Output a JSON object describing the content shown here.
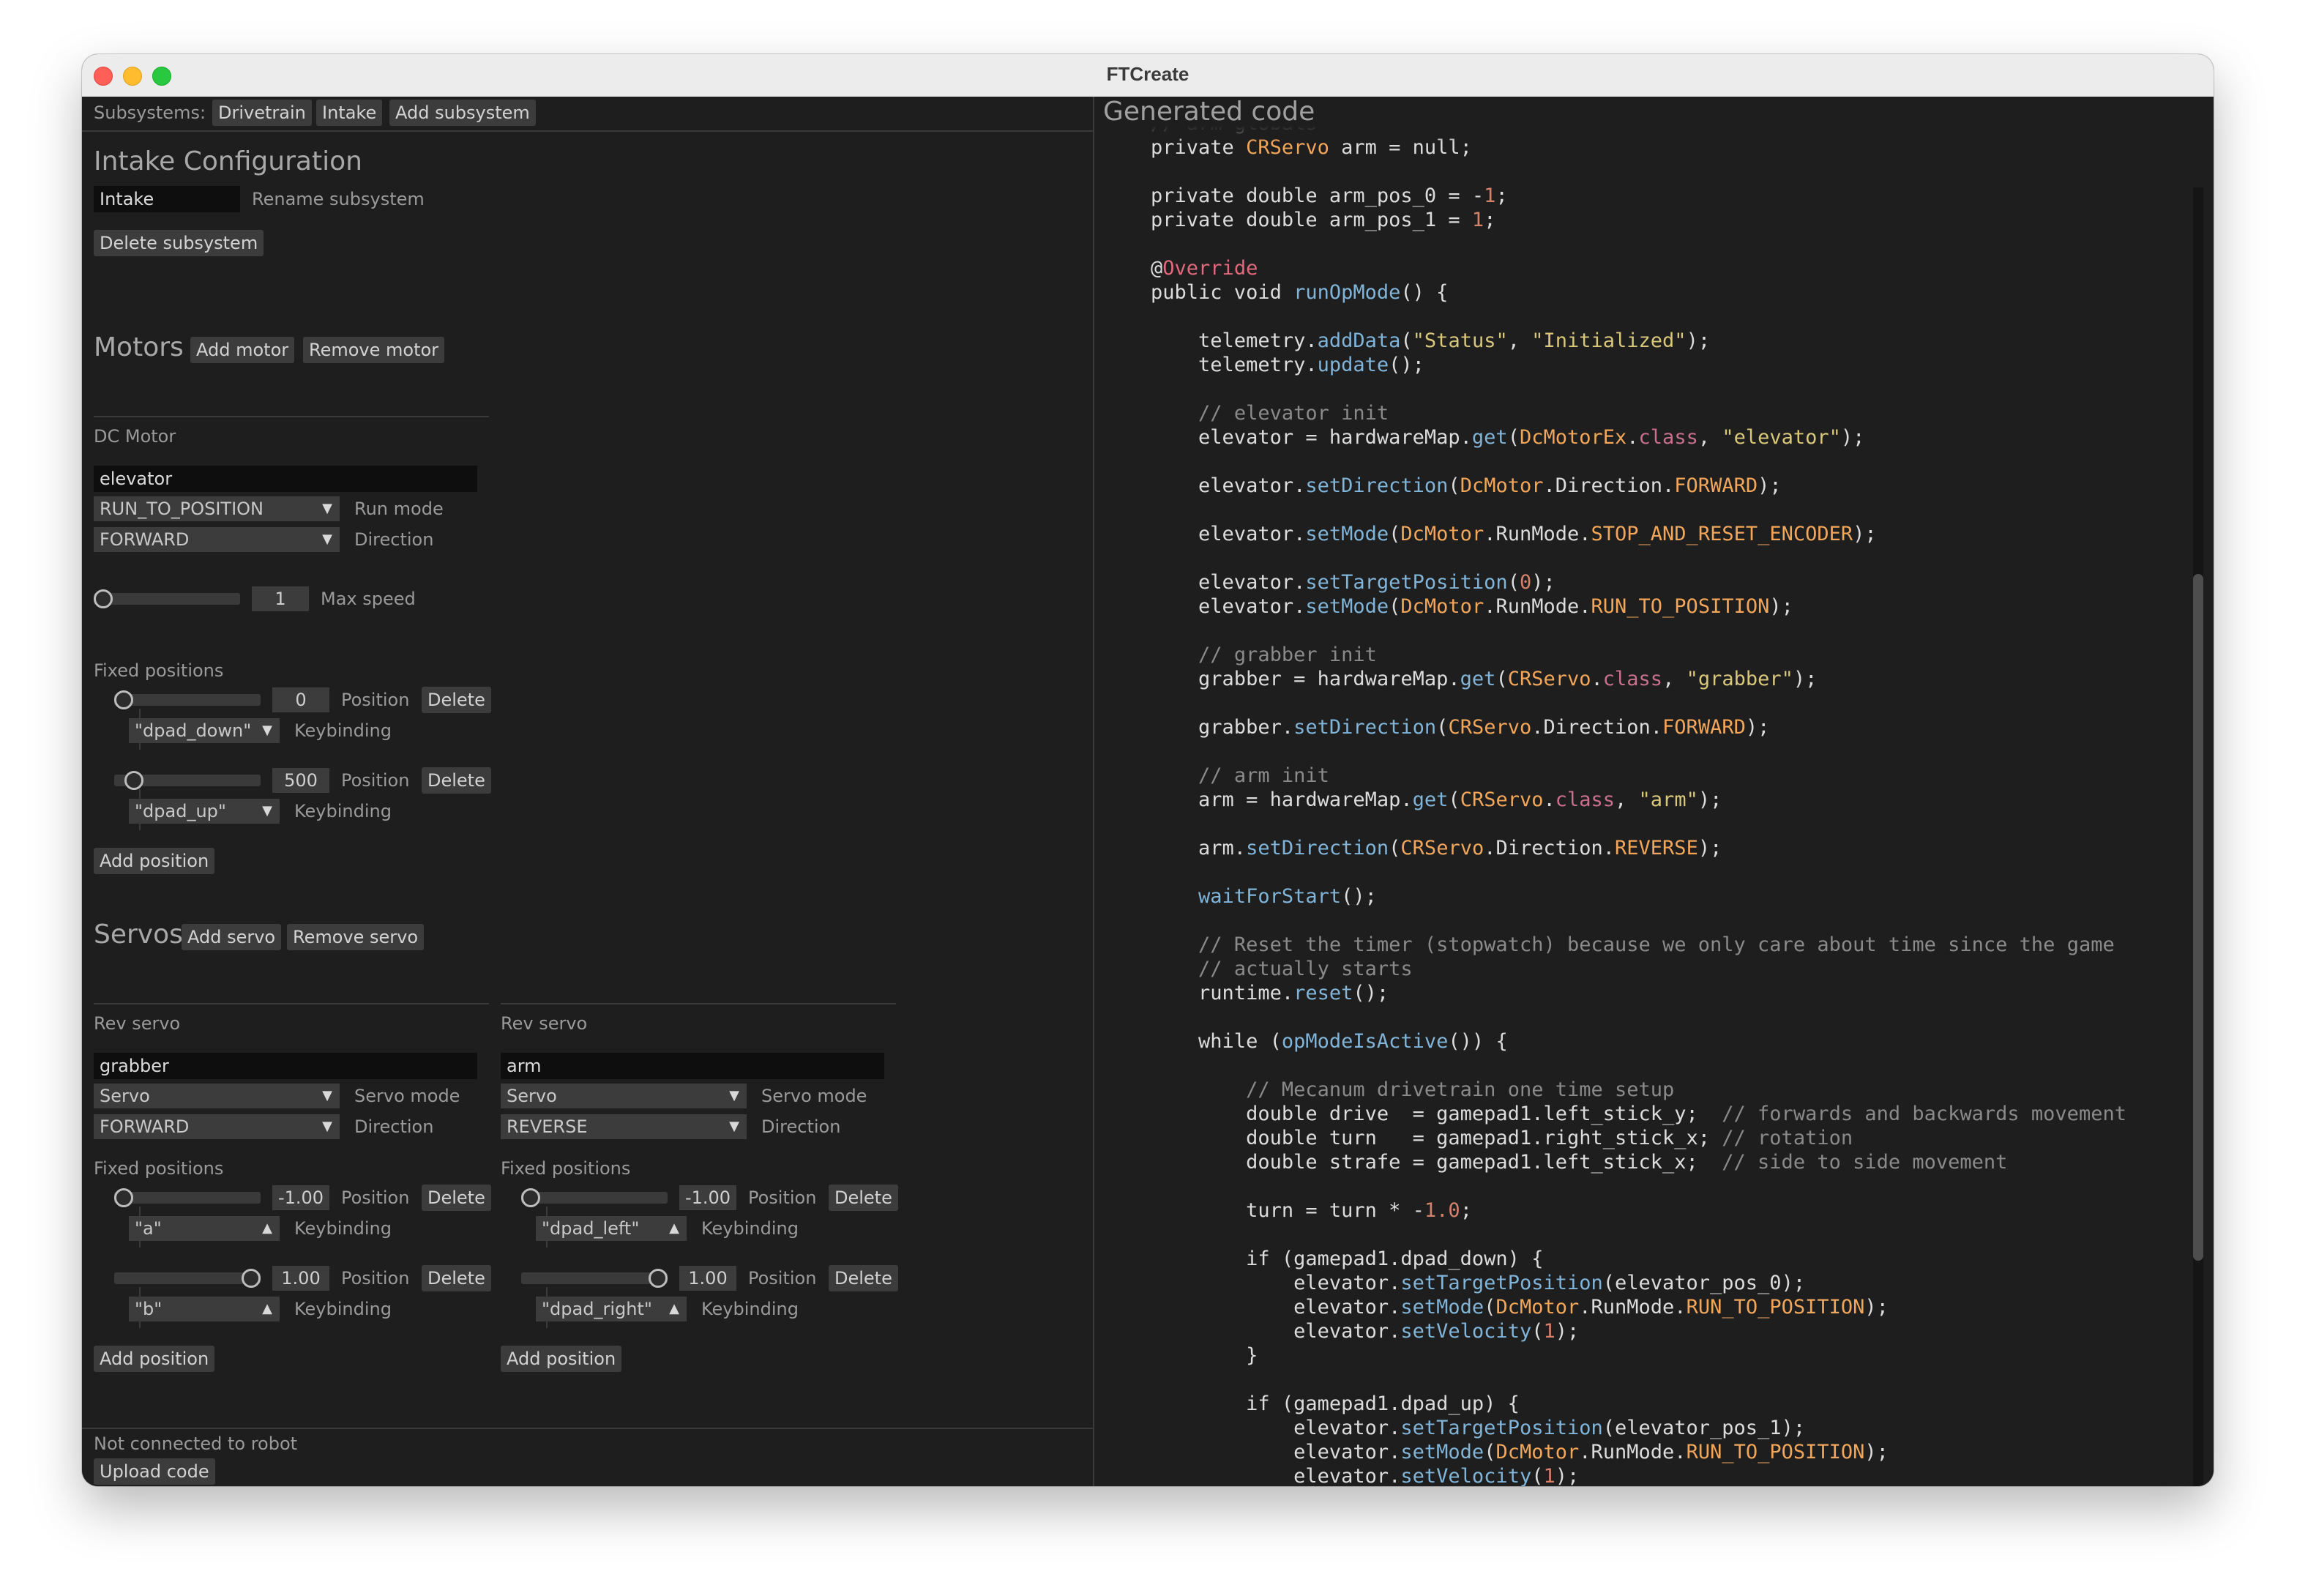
{
  "window": {
    "title": "FTCreate"
  },
  "toolbar": {
    "label": "Subsystems:",
    "tabs": [
      "Drivetrain",
      "Intake"
    ],
    "add_subsystem": "Add subsystem"
  },
  "config": {
    "heading": "Intake Configuration",
    "name_value": "Intake",
    "rename_label": "Rename subsystem",
    "delete_label": "Delete subsystem"
  },
  "motors": {
    "heading": "Motors",
    "add": "Add motor",
    "remove": "Remove motor",
    "items": [
      {
        "type": "DC Motor",
        "name": "elevator",
        "run_mode": "RUN_TO_POSITION",
        "run_mode_label": "Run mode",
        "direction": "FORWARD",
        "direction_label": "Direction",
        "max_speed": "1",
        "max_speed_label": "Max speed",
        "max_speed_level": 0.0,
        "fixed_label": "Fixed positions",
        "positions": [
          {
            "value": "0",
            "level": 0.0,
            "position_label": "Position",
            "delete": "Delete",
            "key": "\"dpad_down\"",
            "key_label": "Keybinding"
          },
          {
            "value": "500",
            "level": 0.08,
            "position_label": "Position",
            "delete": "Delete",
            "key": "\"dpad_up\"",
            "key_label": "Keybinding"
          }
        ],
        "add_position": "Add position"
      }
    ]
  },
  "servos": {
    "heading": "Servos",
    "add": "Add servo",
    "remove": "Remove servo",
    "items": [
      {
        "type": "Rev servo",
        "name": "grabber",
        "mode": "Servo",
        "mode_label": "Servo mode",
        "direction": "FORWARD",
        "direction_label": "Direction",
        "fixed_label": "Fixed positions",
        "positions": [
          {
            "value": "-1.00",
            "level": 0.0,
            "position_label": "Position",
            "delete": "Delete",
            "key": "\"a\"",
            "key_label": "Keybinding"
          },
          {
            "value": "1.00",
            "level": 1.0,
            "position_label": "Position",
            "delete": "Delete",
            "key": "\"b\"",
            "key_label": "Keybinding"
          }
        ],
        "add_position": "Add position"
      },
      {
        "type": "Rev servo",
        "name": "arm",
        "mode": "Servo",
        "mode_label": "Servo mode",
        "direction": "REVERSE",
        "direction_label": "Direction",
        "fixed_label": "Fixed positions",
        "positions": [
          {
            "value": "-1.00",
            "level": 0.0,
            "position_label": "Position",
            "delete": "Delete",
            "key": "\"dpad_left\"",
            "key_label": "Keybinding"
          },
          {
            "value": "1.00",
            "level": 1.0,
            "position_label": "Position",
            "delete": "Delete",
            "key": "\"dpad_right\"",
            "key_label": "Keybinding"
          }
        ],
        "add_position": "Add position"
      }
    ]
  },
  "status": {
    "text": "Not connected to robot",
    "upload": "Upload code"
  },
  "code": {
    "title": "Generated code",
    "lines": [
      "    // arm globals",
      "    private CRServo arm = null;",
      "",
      "    private double arm_pos_0 = -1;",
      "    private double arm_pos_1 = 1;",
      "",
      "    @Override",
      "    public void runOpMode() {",
      "",
      "        telemetry.addData(\"Status\", \"Initialized\");",
      "        telemetry.update();",
      "",
      "        // elevator init",
      "        elevator = hardwareMap.get(DcMotorEx.class, \"elevator\");",
      "",
      "        elevator.setDirection(DcMotor.Direction.FORWARD);",
      "",
      "        elevator.setMode(DcMotor.RunMode.STOP_AND_RESET_ENCODER);",
      "",
      "        elevator.setTargetPosition(0);",
      "        elevator.setMode(DcMotor.RunMode.RUN_TO_POSITION);",
      "",
      "        // grabber init",
      "        grabber = hardwareMap.get(CRServo.class, \"grabber\");",
      "",
      "        grabber.setDirection(CRServo.Direction.FORWARD);",
      "",
      "        // arm init",
      "        arm = hardwareMap.get(CRServo.class, \"arm\");",
      "",
      "        arm.setDirection(CRServo.Direction.REVERSE);",
      "",
      "        waitForStart();",
      "",
      "        // Reset the timer (stopwatch) because we only care about time since the game",
      "        // actually starts",
      "        runtime.reset();",
      "",
      "        while (opModeIsActive()) {",
      "",
      "            // Mecanum drivetrain one time setup",
      "            double drive  = gamepad1.left_stick_y;  // forwards and backwards movement",
      "            double turn   = gamepad1.right_stick_x; // rotation",
      "            double strafe = gamepad1.left_stick_x;  // side to side movement",
      "",
      "            turn = turn * -1.0;",
      "",
      "            if (gamepad1.dpad_down) {",
      "                elevator.setTargetPosition(elevator_pos_0);",
      "                elevator.setMode(DcMotor.RunMode.RUN_TO_POSITION);",
      "                elevator.setVelocity(1);",
      "            }",
      "",
      "            if (gamepad1.dpad_up) {",
      "                elevator.setTargetPosition(elevator_pos_1);",
      "                elevator.setMode(DcMotor.RunMode.RUN_TO_POSITION);",
      "                elevator.setVelocity(1);"
    ]
  }
}
